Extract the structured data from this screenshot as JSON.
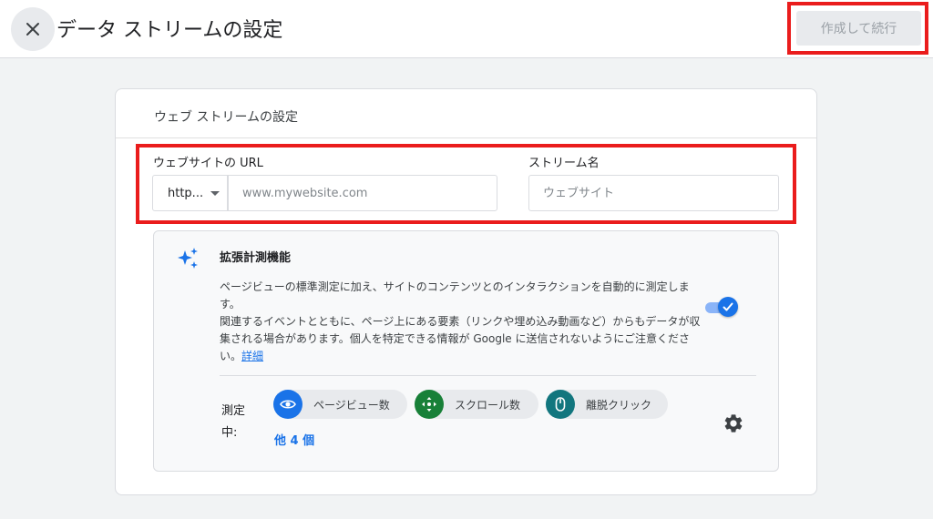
{
  "header": {
    "title": "データ ストリームの設定",
    "create_button": "作成して続行"
  },
  "card": {
    "title": "ウェブ ストリームの設定",
    "website_url": {
      "label": "ウェブサイトの URL",
      "protocol_value": "http...",
      "placeholder": "www.mywebsite.com"
    },
    "stream_name": {
      "label": "ストリーム名",
      "placeholder": "ウェブサイト"
    }
  },
  "enhanced_measurement": {
    "title": "拡張計測機能",
    "description_1": "ページビューの標準測定に加え、サイトのコンテンツとのインタラクションを自動的に測定します。",
    "description_2": "関連するイベントとともに、ページ上にある要素（リンクや埋め込み動画など）からもデータが収集される場合があります。個人を特定できる情報が Google に送信されないようにご注意ください。",
    "details_link": "詳細",
    "enabled": true,
    "measuring_label": "測定中:",
    "chips": [
      {
        "label": "ページビュー数",
        "icon": "eye-icon",
        "color": "#1a73e8"
      },
      {
        "label": "スクロール数",
        "icon": "scroll-arrows-icon",
        "color": "#188038"
      },
      {
        "label": "離脱クリック",
        "icon": "mouse-icon",
        "color": "#12767e"
      }
    ],
    "more_link": "他 4 個"
  },
  "colors": {
    "accent": "#1a73e8",
    "highlight_box": "#ea1c1c"
  }
}
